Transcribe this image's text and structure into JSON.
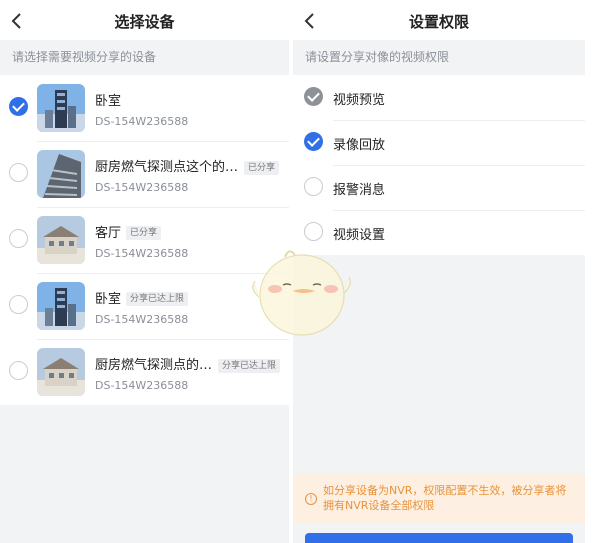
{
  "left": {
    "title": "选择设备",
    "hint": "请选择需要视频分享的设备",
    "devices": [
      {
        "name": "卧室",
        "badge": "",
        "id": "DS-154W236588",
        "checked": true
      },
      {
        "name": "厨房燃气探测点这个的…",
        "badge": "已分享",
        "id": "DS-154W236588",
        "checked": false
      },
      {
        "name": "客厅",
        "badge": "已分享",
        "id": "DS-154W236588",
        "checked": false
      },
      {
        "name": "卧室",
        "badge": "分享已达上限",
        "id": "DS-154W236588",
        "checked": false
      },
      {
        "name": "厨房燃气探测点的…",
        "badge": "分享已达上限",
        "id": "DS-154W236588",
        "checked": false
      }
    ]
  },
  "right": {
    "title": "设置权限",
    "hint": "请设置分享对像的视频权限",
    "permissions": [
      {
        "label": "视频预览",
        "state": "disabled-checked"
      },
      {
        "label": "录像回放",
        "state": "checked"
      },
      {
        "label": "报警消息",
        "state": "unchecked"
      },
      {
        "label": "视频设置",
        "state": "unchecked"
      }
    ],
    "notice_icon": "info-icon",
    "notice": "如分享设备为NVR，权限配置不生效，被分享者将拥有NVR设备全部权限"
  },
  "colors": {
    "accent": "#2f6fe8",
    "warning": "#e8923a",
    "warning_bg": "#fdf0e3"
  }
}
